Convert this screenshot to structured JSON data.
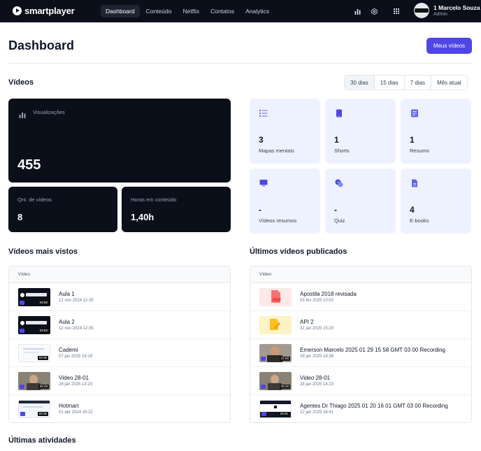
{
  "brand": {
    "name": "smartplayer"
  },
  "nav": {
    "items": [
      {
        "label": "Dashboard",
        "active": true
      },
      {
        "label": "Conteúdo",
        "active": false
      },
      {
        "label": "Netflix",
        "active": false
      },
      {
        "label": "Contatos",
        "active": false
      },
      {
        "label": "Analytics",
        "active": false
      }
    ]
  },
  "topbar_icons": [
    "bar-chart-icon",
    "settings-icon",
    "grid-icon"
  ],
  "user": {
    "name": "1 Marcelo Souza",
    "role": "Admin"
  },
  "header": {
    "title": "Dashboard",
    "primary_button": "Meus vídeos"
  },
  "videos_section": {
    "title": "Vídeos",
    "ranges": [
      {
        "label": "30 dias",
        "active": true
      },
      {
        "label": "15 dias",
        "active": false
      },
      {
        "label": "7 dias",
        "active": false
      },
      {
        "label": "Mês atual",
        "active": false
      }
    ]
  },
  "stats": {
    "views": {
      "label": "Visualizações",
      "value": "455"
    },
    "video_count": {
      "label": "Qnt. de vídeos",
      "value": "8"
    },
    "hours": {
      "label": "Horas em conteúdo",
      "value": "1,40h"
    }
  },
  "content_cards": [
    {
      "icon": "list-icon",
      "value": "3",
      "label": "Mapas mentais"
    },
    {
      "icon": "phone-icon",
      "value": "1",
      "label": "Shorts"
    },
    {
      "icon": "document-icon",
      "value": "1",
      "label": "Resumo"
    },
    {
      "icon": "monitor-icon",
      "value": "-",
      "label": "Vídeos resumos"
    },
    {
      "icon": "quiz-icon",
      "value": "-",
      "label": "Quiz"
    },
    {
      "icon": "ebook-icon",
      "value": "4",
      "label": "E-books"
    }
  ],
  "most_viewed": {
    "title": "Vídeos mais vistos",
    "column": "Vídeo",
    "rows": [
      {
        "title": "Aula 1",
        "date": "12 nov 2024 12:35",
        "duration": "04:50",
        "thumb": "brand"
      },
      {
        "title": "Aula 2",
        "date": "12 nov 2024 12:35",
        "duration": "04:50",
        "thumb": "brand"
      },
      {
        "title": "Cademi",
        "date": "07 jan 2025 16:19",
        "duration": "02:06",
        "thumb": "page"
      },
      {
        "title": "Video 28-01",
        "date": "28 jan 2025 14:23",
        "duration": "05:29",
        "thumb": "person"
      },
      {
        "title": "Hotmart",
        "date": "01 abr 2024 16:22",
        "duration": "02:36",
        "thumb": "page"
      }
    ]
  },
  "latest_published": {
    "title": "Últimos vídeos publicados",
    "column": "Vídeo",
    "rows": [
      {
        "title": "Apostila 2018 revisada",
        "date": "03 fev 2025 10:52",
        "thumb": "pdf",
        "file_label": "PDF"
      },
      {
        "title": "API 2",
        "date": "31 jan 2025 15:20",
        "thumb": "edit"
      },
      {
        "title": "Emerson Marcelo 2025 01 29 15 58 GMT 03 00 Recording",
        "date": "29 jan 2025 18:38",
        "duration": "21:00",
        "thumb": "person"
      },
      {
        "title": "Video 28-01",
        "date": "28 jan 2025 14:23",
        "duration": "05:29",
        "thumb": "person"
      },
      {
        "title": "Agentes Dr Thiago 2025 01 20 16 01 GMT 03 00 Recording",
        "date": "22 jan 2025 16:41",
        "duration": "29:31",
        "thumb": "screen"
      }
    ]
  },
  "activities": {
    "title": "Últimas atividades"
  },
  "colors": {
    "accent": "#4f46e5",
    "dark": "#0b0f1a",
    "card_light": "#eef2ff"
  }
}
